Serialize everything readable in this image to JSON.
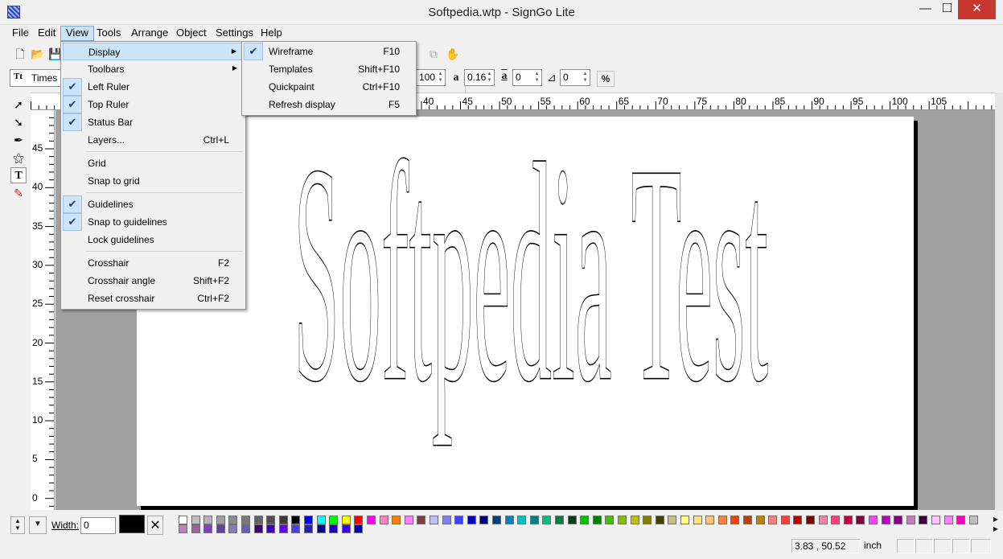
{
  "window": {
    "title": "Softpedia.wtp - SignGo Lite",
    "min_glyph": "—",
    "max_glyph": "☐",
    "close_glyph": "✕"
  },
  "menubar": [
    {
      "label": "File",
      "active": false
    },
    {
      "label": "Edit",
      "active": false
    },
    {
      "label": "View",
      "active": true
    },
    {
      "label": "Tools",
      "active": false
    },
    {
      "label": "Arrange",
      "active": false
    },
    {
      "label": "Object",
      "active": false
    },
    {
      "label": "Settings",
      "active": false
    },
    {
      "label": "Help",
      "active": false
    }
  ],
  "toolbar": {
    "font_glyph": "Tt",
    "font_name": "Times",
    "size_value": "100",
    "spacing_value": "0.16",
    "line_spacing_value": "0",
    "angle_value": "0",
    "percent_label": "%",
    "spacing_icon": "a",
    "line_spacing_icon": "a"
  },
  "view_menu": {
    "items": [
      {
        "label": "Display",
        "shortcut": "",
        "checked": false,
        "submenu": true,
        "highlight": true
      },
      {
        "label": "Toolbars",
        "shortcut": "",
        "checked": false,
        "submenu": true
      },
      {
        "label": "Left Ruler",
        "shortcut": "",
        "checked": true
      },
      {
        "label": "Top Ruler",
        "shortcut": "",
        "checked": true
      },
      {
        "label": "Status Bar",
        "shortcut": "",
        "checked": true
      },
      {
        "label": "Layers...",
        "shortcut": "Ctrl+L",
        "checked": false
      },
      {
        "label": "Grid",
        "shortcut": "",
        "checked": false
      },
      {
        "label": "Snap to grid",
        "shortcut": "",
        "checked": false
      },
      {
        "label": "Guidelines",
        "shortcut": "",
        "checked": true
      },
      {
        "label": "Snap to guidelines",
        "shortcut": "",
        "checked": true
      },
      {
        "label": "Lock guidelines",
        "shortcut": "",
        "checked": false
      },
      {
        "label": "Crosshair",
        "shortcut": "F2",
        "checked": false
      },
      {
        "label": "Crosshair angle",
        "shortcut": "Shift+F2",
        "checked": false
      },
      {
        "label": "Reset crosshair",
        "shortcut": "Ctrl+F2",
        "checked": false
      }
    ]
  },
  "display_submenu": {
    "items": [
      {
        "label": "Wireframe",
        "shortcut": "F10",
        "checked": true
      },
      {
        "label": "Templates",
        "shortcut": "Shift+F10",
        "checked": false
      },
      {
        "label": "Quickpaint",
        "shortcut": "Ctrl+F10",
        "checked": false
      },
      {
        "label": "Refresh display",
        "shortcut": "F5",
        "checked": false
      }
    ]
  },
  "ruler_top_labels": [
    "40",
    "45",
    "50",
    "55",
    "60",
    "65",
    "70",
    "75",
    "80",
    "85",
    "90",
    "95",
    "100",
    "105"
  ],
  "ruler_left_labels": [
    "45",
    "40",
    "35",
    "30",
    "25",
    "20",
    "15",
    "10",
    "5",
    "0"
  ],
  "canvas": {
    "text": "Softpedia Test"
  },
  "bottom": {
    "width_label": "Width:",
    "width_value": "0",
    "no_color_glyph": "✕"
  },
  "palette_row1": [
    "#ffffff",
    "#c0c0c0",
    "#b4b4b4",
    "#a0a0a0",
    "#8c8c8c",
    "#787878",
    "#646464",
    "#505050",
    "#3c3c3c",
    "#000000",
    "#0000ff",
    "#00ffff",
    "#00ff00",
    "#ffff00",
    "#ff0000",
    "#ff00ff",
    "#ff80c0",
    "#ff8000",
    "#ff80ff",
    "#804040",
    "#c0c0ff",
    "#8080ff",
    "#4040ff",
    "#0000c0",
    "#000080",
    "#004080",
    "#0080c0",
    "#00c0c0",
    "#008080",
    "#00c080",
    "#008040",
    "#004020",
    "#00c000",
    "#008000",
    "#40c000",
    "#80c000",
    "#c0c000",
    "#808000",
    "#404000",
    "#c0c080",
    "#ffff80",
    "#ffe080",
    "#ffc080",
    "#ff8040",
    "#ff4000",
    "#c04000",
    "#c08000",
    "#ff8080",
    "#ff4040",
    "#c00000",
    "#800000",
    "#ff80a0",
    "#ff4080",
    "#c00040",
    "#800040",
    "#ff40ff",
    "#c000c0",
    "#800080",
    "#c080c0",
    "#400040",
    "#ffc0ff",
    "#ff80ff",
    "#ff00c0",
    "#c0c0c0"
  ],
  "palette_row2": [
    "#c080c0",
    "#a060a0",
    "#8040c0",
    "#6040a0",
    "#8080c0",
    "#6060c0",
    "#400080",
    "#4000c0",
    "#6000ff",
    "#4040ff",
    "#2020c0",
    "#0000a0",
    "#2000c0",
    "#4000ff",
    "#0000c0"
  ],
  "status": {
    "coords": "3.83  ,  50.52",
    "unit": "inch"
  }
}
